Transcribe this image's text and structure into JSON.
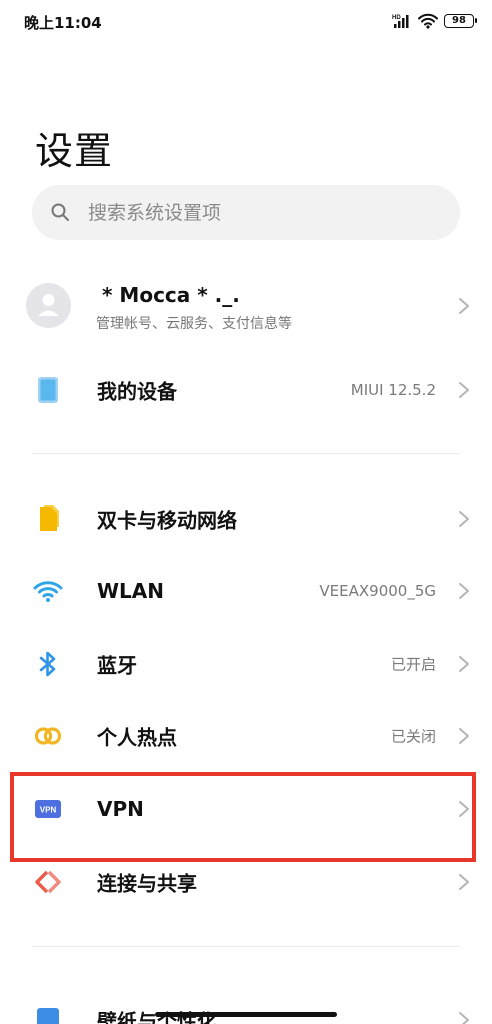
{
  "status": {
    "time": "晚上11:04",
    "hd_label": "HD",
    "battery": "98"
  },
  "page": {
    "title": "设置"
  },
  "search": {
    "placeholder": "搜索系统设置项"
  },
  "profile": {
    "name": "* Mocca * ._.",
    "subtitle": "管理帐号、云服务、支付信息等"
  },
  "device": {
    "label": "我的设备",
    "value": "MIUI 12.5.2"
  },
  "items": [
    {
      "label": "双卡与移动网络",
      "value": "",
      "icon": "sim-card-icon",
      "color": "#f5b800"
    },
    {
      "label": "WLAN",
      "value": "VEEAX9000_5G",
      "icon": "wifi-icon",
      "color": "#2fa5e6"
    },
    {
      "label": "蓝牙",
      "value": "已开启",
      "icon": "bluetooth-icon",
      "color": "#2f95e8"
    },
    {
      "label": "个人热点",
      "value": "已关闭",
      "icon": "hotspot-icon",
      "color": "#f3b622"
    },
    {
      "label": "VPN",
      "value": "",
      "icon": "vpn-icon",
      "icon_text": "VPN",
      "color": "#4e6fe0"
    },
    {
      "label": "连接与共享",
      "value": "",
      "icon": "connection-sharing-icon",
      "color": "#ec5a4a"
    }
  ],
  "partial_item": {
    "label": "壁纸与个性化",
    "icon": "wallpaper-icon",
    "color": "#3d8de6"
  },
  "highlight_color": "#e8382c"
}
